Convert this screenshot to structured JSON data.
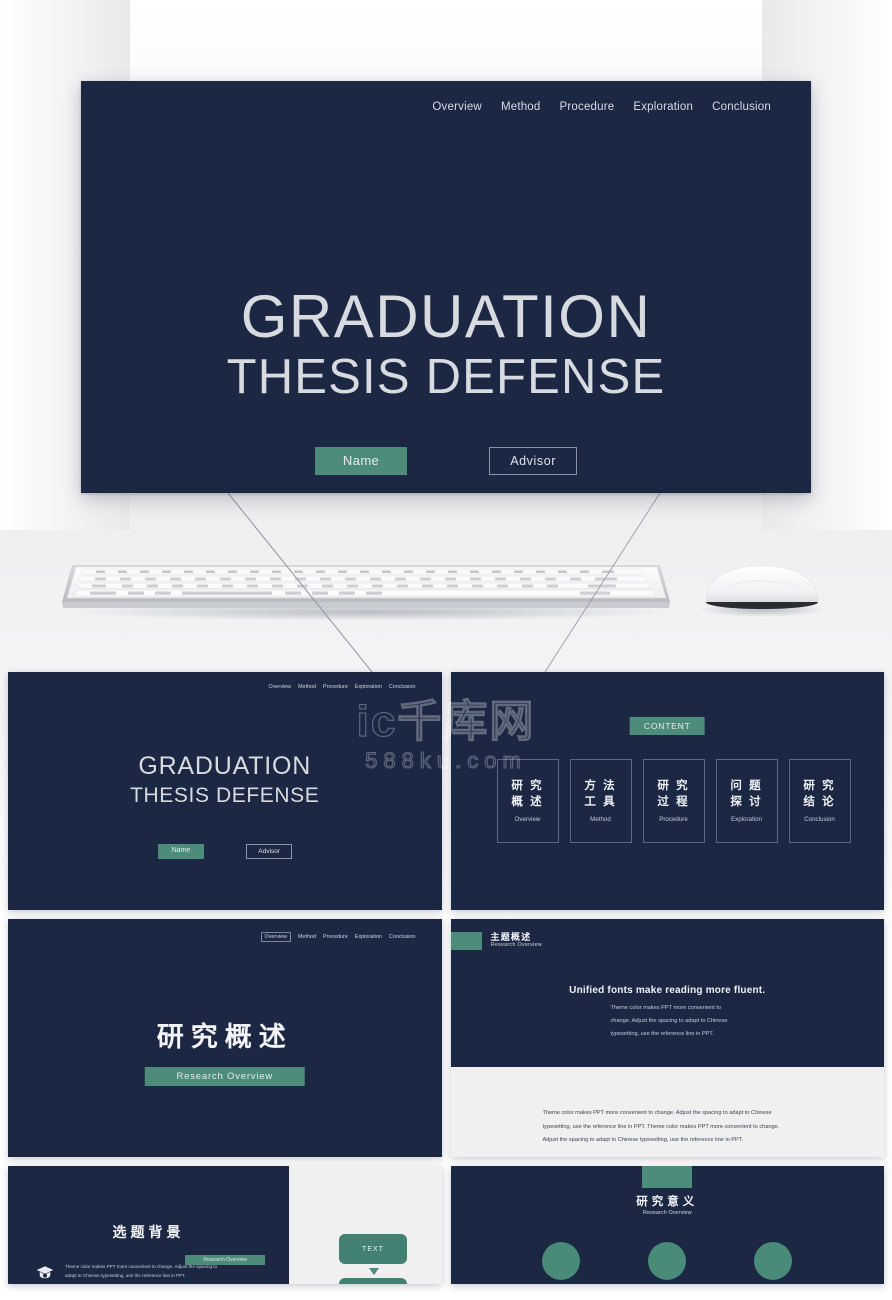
{
  "hero": {
    "nav": [
      "Overview",
      "Method",
      "Procedure",
      "Exploration",
      "Conclusion"
    ],
    "title_line1": "GRADUATION",
    "title_line2": "THESIS DEFENSE",
    "name_button": "Name",
    "advisor_button": "Advisor"
  },
  "watermark": {
    "line1": "ic千库网",
    "line2": "588ku.com"
  },
  "thumbnails": [
    {
      "id": "slide-title",
      "nav": [
        "Overview",
        "Method",
        "Procedure",
        "Exploration",
        "Conclusion"
      ],
      "title_line1": "GRADUATION",
      "title_line2": "THESIS DEFENSE",
      "name_button": "Name",
      "advisor_button": "Advisor"
    },
    {
      "id": "slide-content",
      "badge": "CONTENT",
      "boxes": [
        {
          "cn_line1": "研 究",
          "cn_line2": "概 述",
          "en": "Overview"
        },
        {
          "cn_line1": "方 法",
          "cn_line2": "工 具",
          "en": "Method"
        },
        {
          "cn_line1": "研 究",
          "cn_line2": "过 程",
          "en": "Procedure"
        },
        {
          "cn_line1": "问 题",
          "cn_line2": "探 讨",
          "en": "Exploration"
        },
        {
          "cn_line1": "研 究",
          "cn_line2": "结 论",
          "en": "Conclusion"
        }
      ]
    },
    {
      "id": "slide-section-overview",
      "nav": [
        "Overview",
        "Method",
        "Procedure",
        "Exploration",
        "Conclusion"
      ],
      "active_nav": "Overview",
      "title": "研究概述",
      "subtitle": "Research Overview"
    },
    {
      "id": "slide-theme-overview",
      "header_cn": "主题概述",
      "header_en": "Research Overview",
      "lead": "Unified fonts make reading more fluent.",
      "body": "Theme color makes PPT more convenient to change. Adjust the spacing to adapt to Chinese typesetting, use the reference line in PPT.",
      "white_text": "Theme color makes PPT more convenient to change. Adjust the spacing to adapt to Chinese typesetting, use the reference line in PPT. Theme color makes PPT more convenient to change. Adjust the spacing to adapt to Chinese typesetting, use the reference line in PPT."
    },
    {
      "id": "slide-topic-background",
      "title": "选题背景",
      "subtitle": "Research Overview",
      "paragraph": "Theme color makes PPT more convenient to change. Adjust the spacing to adapt to Chinese typesetting, use the reference line in PPT.",
      "text_box": "TEXT",
      "icon": "graduation-cap-icon"
    },
    {
      "id": "slide-research-significance",
      "title_cn": "研究意义",
      "title_en": "Research Overview",
      "circle_count": 3
    }
  ],
  "colors": {
    "navy": "#1b2743",
    "teal": "#4d8c7b",
    "light_text": "#d7dadf",
    "panel_light": "#f0f0f1"
  }
}
